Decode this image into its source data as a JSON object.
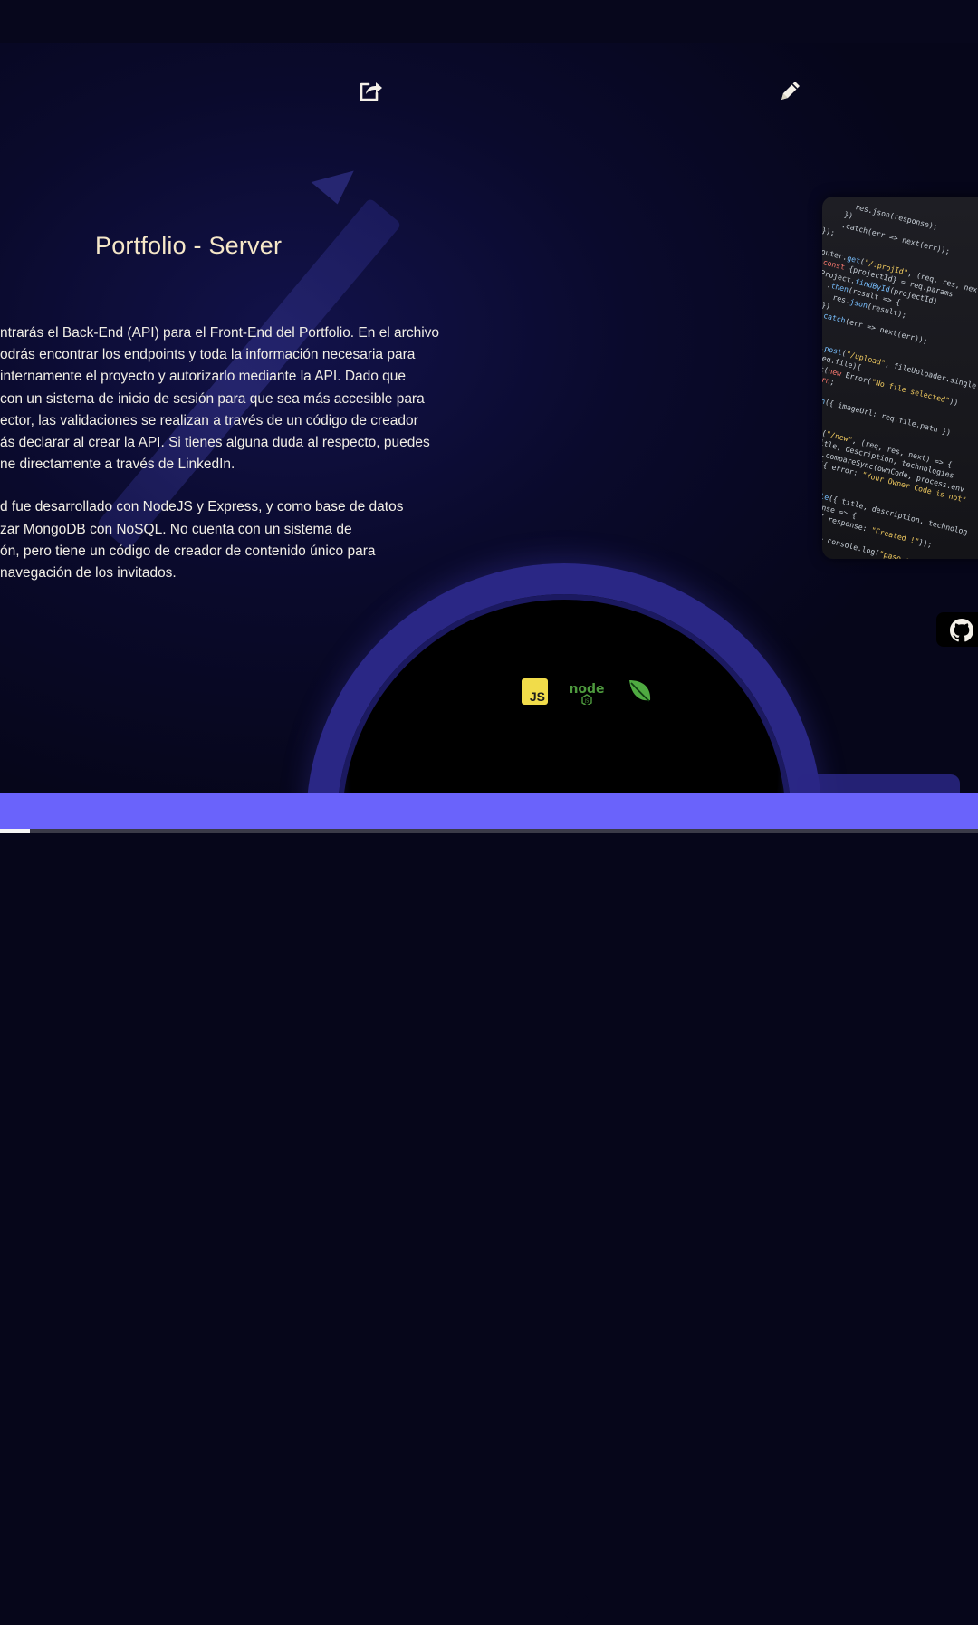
{
  "project": {
    "title": "Portfolio - Server",
    "description_paragraph_1_lines": [
      "ntrarás el Back-End (API) para el Front-End del Portfolio. En el archivo",
      "odrás encontrar los endpoints y toda la información necesaria para",
      " internamente el proyecto y autorizarlo mediante la API. Dado que",
      "con un sistema de inicio de sesión para que sea más accesible para",
      "ector, las validaciones se realizan a través de un código de creador",
      "ás declarar al crear la API. Si tienes alguna duda al respecto, puedes",
      "ne directamente a través de LinkedIn."
    ],
    "description_paragraph_2_lines": [
      "d fue desarrollado con NodeJS y Express, y como base de datos",
      "zar MongoDB con NoSQL. No cuenta con un sistema de",
      "ón, pero tiene un código de creador de contenido único para",
      "navegación de los invitados."
    ]
  },
  "actions": {
    "share_icon": "share-square-icon",
    "edit_icon": "pencil-icon"
  },
  "technologies": [
    {
      "name": "JavaScript",
      "icon": "js-icon",
      "label": "JS"
    },
    {
      "name": "Node.js",
      "icon": "node-icon",
      "label": "node"
    },
    {
      "name": "MongoDB",
      "icon": "mongodb-leaf-icon"
    }
  ],
  "links": {
    "side_icon": "github-icon",
    "footer_icon": "github-icon"
  },
  "colors": {
    "background": "#06061a",
    "title": "#f5e7c8",
    "footer": "#6a63fb",
    "divider": "#5a58c8",
    "js_yellow": "#f1dc4a",
    "node_green": "#4e9a3e",
    "mongo_green": "#4faa41"
  }
}
